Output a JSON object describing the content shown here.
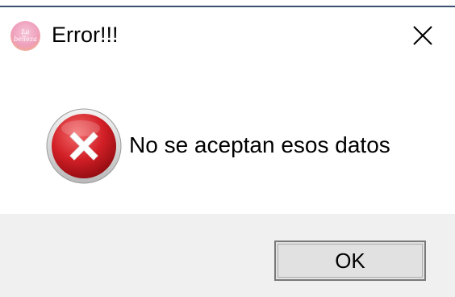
{
  "dialog": {
    "title": "Error!!!",
    "app_icon_text": "La belleza",
    "message": "No se aceptan esos datos",
    "ok_label": "OK",
    "icons": {
      "app": "app-logo-icon",
      "close": "close-icon",
      "error": "error-icon"
    },
    "colors": {
      "footer_bg": "#f0f0f0",
      "error_red": "#d21f26",
      "button_bg": "#e1e1e1"
    }
  }
}
